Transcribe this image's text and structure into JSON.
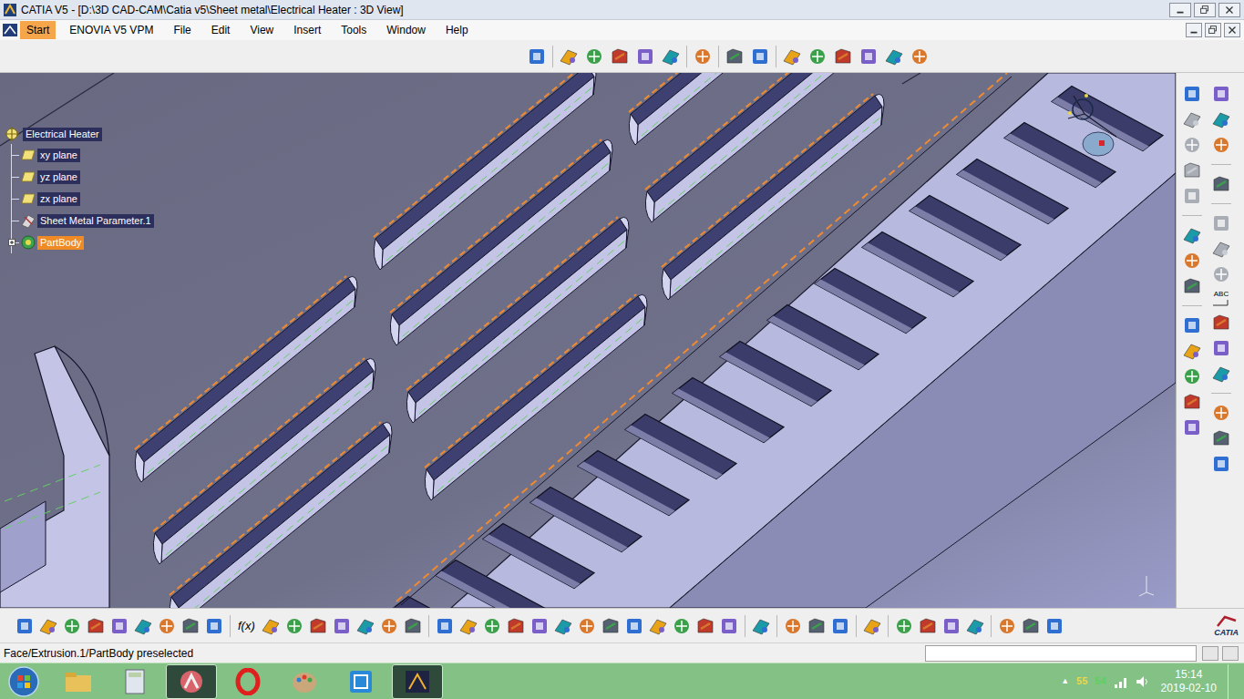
{
  "window": {
    "title": "CATIA V5 - [D:\\3D CAD-CAM\\Catia v5\\Sheet metal\\Electrical Heater : 3D View]"
  },
  "menu": [
    {
      "label": "Start",
      "selected": true
    },
    {
      "label": "ENOVIA V5 VPM",
      "selected": false
    },
    {
      "label": "File",
      "selected": false
    },
    {
      "label": "Edit",
      "selected": false
    },
    {
      "label": "View",
      "selected": false
    },
    {
      "label": "Insert",
      "selected": false
    },
    {
      "label": "Tools",
      "selected": false
    },
    {
      "label": "Window",
      "selected": false
    },
    {
      "label": "Help",
      "selected": false
    }
  ],
  "tree": {
    "root": "Electrical Heater",
    "items": [
      {
        "label": "xy plane",
        "selected": false,
        "expandable": false,
        "kind": "plane"
      },
      {
        "label": "yz plane",
        "selected": false,
        "expandable": false,
        "kind": "plane"
      },
      {
        "label": "zx plane",
        "selected": false,
        "expandable": false,
        "kind": "plane"
      },
      {
        "label": "Sheet Metal Parameter.1",
        "selected": false,
        "expandable": false,
        "kind": "parameter"
      },
      {
        "label": "PartBody",
        "selected": true,
        "expandable": true,
        "kind": "body"
      }
    ]
  },
  "toolbar_labels": {
    "formula": "f(x)",
    "text_tool": "ABC"
  },
  "logo": "CATIA",
  "status_bar": {
    "text": "Face/Extrusion.1/PartBody preselected"
  },
  "taskbar": {
    "show_hidden": "▲",
    "tray": [
      {
        "label": "55",
        "color": "#e8d84a"
      },
      {
        "label": "54",
        "color": "#5fd05f"
      }
    ],
    "time": "15:14",
    "date": "2019-02-10"
  }
}
